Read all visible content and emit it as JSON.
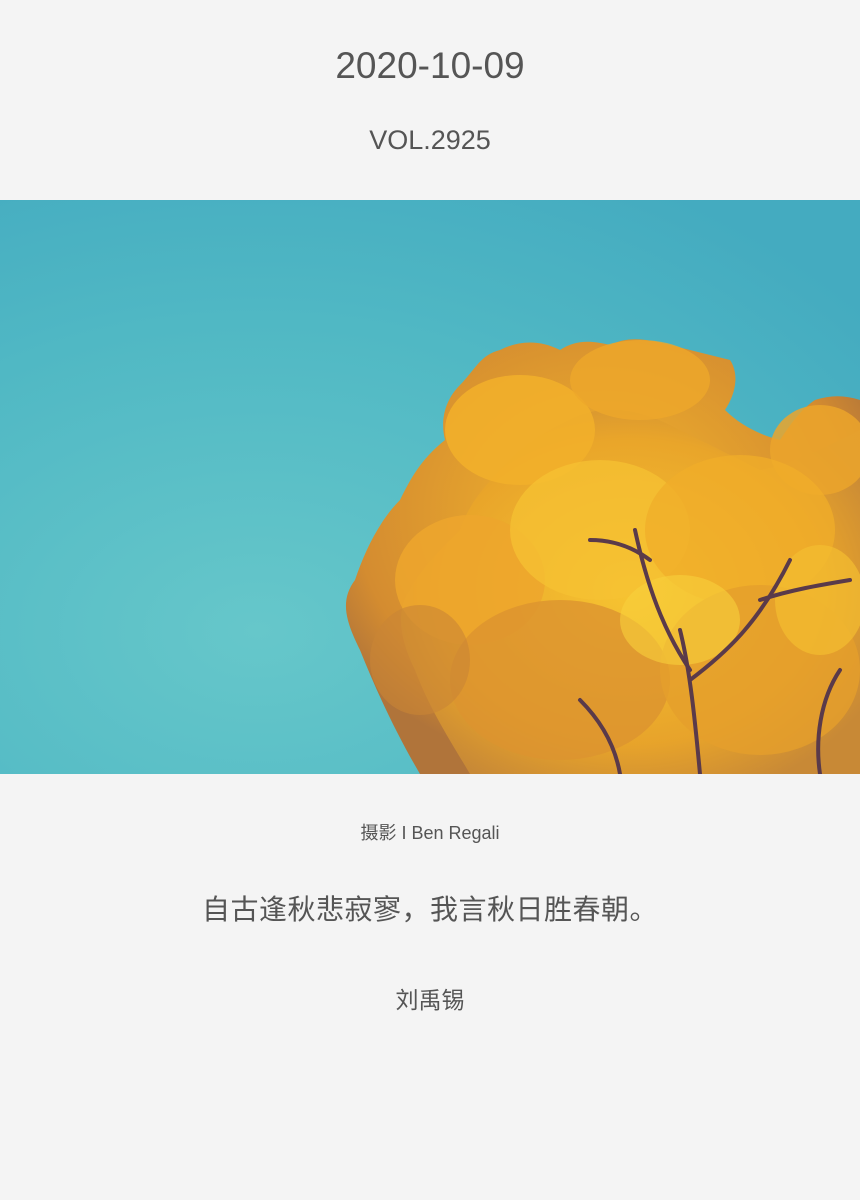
{
  "header": {
    "date": "2020-10-09",
    "volume": "VOL.2925"
  },
  "photo": {
    "subject": "autumn-maple-tree",
    "sky_color": "#4fb9c4",
    "foliage_color": "#f0b023"
  },
  "credit": {
    "text": "摄影 I Ben Regali"
  },
  "quote": {
    "text": "自古逢秋悲寂寥，我言秋日胜春朝。",
    "author": "刘禹锡"
  }
}
